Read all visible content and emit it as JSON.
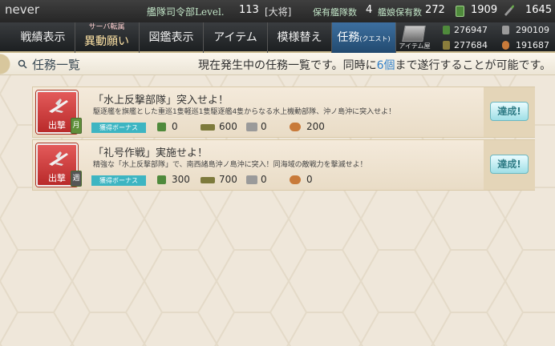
{
  "topbar": {
    "player": "never",
    "level_label": "艦隊司令部Level.",
    "level": "113",
    "rank": "[大将]",
    "ships_label": "保有艦隊数",
    "ships": "4",
    "equip_label": "艦娘保有数",
    "equip": "272",
    "buckets": "1909",
    "torches": "1645"
  },
  "nav": {
    "record": "戦績表示",
    "server_small": "サーバ転属",
    "server_big": "異動願い",
    "library": "図鑑表示",
    "items": "アイテム",
    "remodel": "模様替え",
    "quest": "任務",
    "quest_sub": "(クエスト)",
    "item_shop": "アイテム屋",
    "fuel": "276947",
    "steel": "290109",
    "ammo": "277684",
    "bauxite": "191687"
  },
  "header": {
    "title": "任務一覧",
    "msg_before": "現在発生中の任務一覧です。同時に",
    "msg_highlight": "6個",
    "msg_after": "まで遂行することが可能です。"
  },
  "quests": [
    {
      "category": "出撃",
      "cycle": "月",
      "title": "「水上反撃部隊」突入せよ！",
      "desc": "駆逐艦を旗艦とした重巡1隻軽巡1隻駆逐艦4隻からなる水上機動部隊、沖ノ島沖に突入せよ！",
      "bonus_label": "獲得ボーナス",
      "fuel": "0",
      "ammo": "600",
      "steel": "0",
      "bauxite": "200",
      "done": "達成!"
    },
    {
      "category": "出撃",
      "cycle": "週",
      "title": "「礼号作戦」実施せよ！",
      "desc": "精強な「水上反撃部隊」で、南西諸島沖ノ島沖に突入！同海域の敵戦力を撃滅せよ！",
      "bonus_label": "獲得ボーナス",
      "fuel": "300",
      "ammo": "700",
      "steel": "0",
      "bauxite": "0",
      "done": "達成!"
    }
  ],
  "colors": {
    "category_red": "#c93636",
    "done_teal": "#9fdfe6",
    "highlight_blue": "#2f7fc9",
    "bonus_teal": "#3db5c2"
  }
}
